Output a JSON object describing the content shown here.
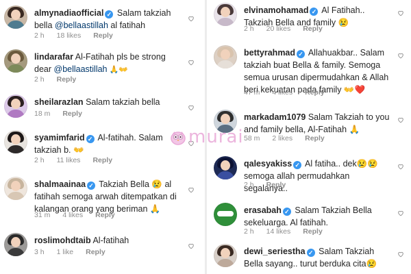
{
  "left": [
    {
      "username": "almynadiaofficial",
      "verified": true,
      "segments": [
        {
          "t": "Salam takziah bella ",
          "m": false
        },
        {
          "t": "@bellaastillah",
          "m": true
        },
        {
          "t": " al fatihah",
          "m": false
        }
      ],
      "time": "2 h",
      "likes": "18 likes",
      "reply": "Reply"
    },
    {
      "username": "lindarafar",
      "verified": false,
      "segments": [
        {
          "t": "Al-Fatihah pls be strong dear ",
          "m": false
        },
        {
          "t": "@bellaastillah",
          "m": true
        },
        {
          "t": " 🙏👐",
          "m": false
        }
      ],
      "time": "2 h",
      "likes": "",
      "reply": "Reply"
    },
    {
      "username": "sheilarazlan",
      "verified": false,
      "segments": [
        {
          "t": "Salam takziah bella",
          "m": false
        }
      ],
      "time": "18 m",
      "likes": "",
      "reply": "Reply"
    },
    {
      "username": "syamimfarid",
      "verified": true,
      "segments": [
        {
          "t": "Al-fatihah. Salam takziah b. 👐",
          "m": false
        }
      ],
      "time": "2 h",
      "likes": "11 likes",
      "reply": "Reply"
    },
    {
      "username": "shalmaainaa",
      "verified": true,
      "segments": [
        {
          "t": "Takziah Bella 😢 al fatihah semoga arwah ditempatkan di kalangan orang yang beriman 🙏",
          "m": false
        }
      ],
      "time": "31 m",
      "likes": "4 likes",
      "reply": "Reply"
    },
    {
      "username": "roslimohdtaib",
      "verified": false,
      "segments": [
        {
          "t": "Al-fatihah",
          "m": false
        }
      ],
      "time": "3 h",
      "likes": "1 like",
      "reply": "Reply"
    }
  ],
  "right": [
    {
      "username": "elvinamohamad",
      "verified": true,
      "segments": [
        {
          "t": "Al Fatihah.. Takziah Bella and family 😢",
          "m": false
        }
      ],
      "time": "2 h",
      "likes": "20 likes",
      "reply": "Reply"
    },
    {
      "username": "bettyrahmad",
      "verified": true,
      "segments": [
        {
          "t": "Allahuakbar.. Salam takziah buat Bella & family. Semoga semua urusan dipermudahkan & Allah beri kekuatan pada family 👐❤️",
          "m": false
        }
      ],
      "time": "47 m",
      "likes": "4 likes",
      "reply": "Reply"
    },
    {
      "username": "markadam1079",
      "verified": false,
      "segments": [
        {
          "t": "Salam Takziah to you and family bella, Al-Fatihah 🙏",
          "m": false
        }
      ],
      "time": "58 m",
      "likes": "2 likes",
      "reply": "Reply"
    },
    {
      "username": "qalesyakiss",
      "verified": true,
      "segments": [
        {
          "t": "Al fatiha.. dek😢😢 semoga allah permudahkan segalanya..",
          "m": false
        }
      ],
      "time": "2 h",
      "likes": "",
      "reply": "Reply"
    },
    {
      "username": "erasabah",
      "verified": true,
      "segments": [
        {
          "t": "Salam Takziah Bella sekeluarga. Al fatihah.",
          "m": false
        }
      ],
      "time": "2 h",
      "likes": "14 likes",
      "reply": "Reply"
    },
    {
      "username": "dewi_seriestha",
      "verified": true,
      "segments": [
        {
          "t": "Salam Takziah Bella sayang.. turut berduka cita😢",
          "m": false
        }
      ],
      "time": "",
      "likes": "",
      "reply": ""
    }
  ],
  "watermark": {
    "text": "murai"
  },
  "colors": {
    "verified": "#3897f0",
    "mention": "#00376b",
    "meta": "#8e8e8e",
    "watermark": "#e9a9d8"
  }
}
